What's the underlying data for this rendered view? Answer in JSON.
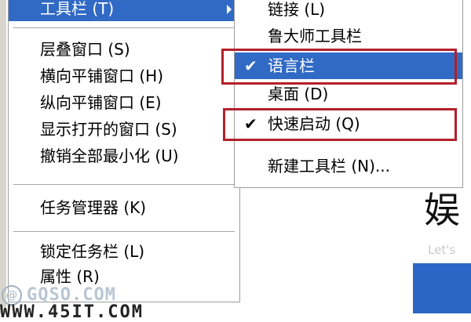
{
  "main_menu": {
    "toolbar_item": "工具栏 (T)",
    "group1": [
      "层叠窗口 (S)",
      "横向平铺窗口 (H)",
      "纵向平铺窗口 (E)",
      "显示打开的窗口 (S)",
      "撤销全部最小化 (U)"
    ],
    "task_manager": "任务管理器 (K)",
    "lock_taskbar": "锁定任务栏 (L)",
    "properties": "属性 (R)"
  },
  "submenu": {
    "links": "链接 (L)",
    "ludashi": "鲁大师工具栏",
    "language_bar": "语言栏",
    "desktop": "桌面 (D)",
    "quick_launch": "快速启动 (Q)",
    "new_toolbar": "新建工具栏 (N)...",
    "check_glyph": "✔"
  },
  "background": {
    "large_char": "娱",
    "small_text": "Let's"
  },
  "watermark": {
    "logo": "@",
    "site": "GQSO.COM",
    "url": "WWW.45IT.COM"
  },
  "colors": {
    "highlight": "#316ac5",
    "annotation_border": "#b3202a"
  }
}
